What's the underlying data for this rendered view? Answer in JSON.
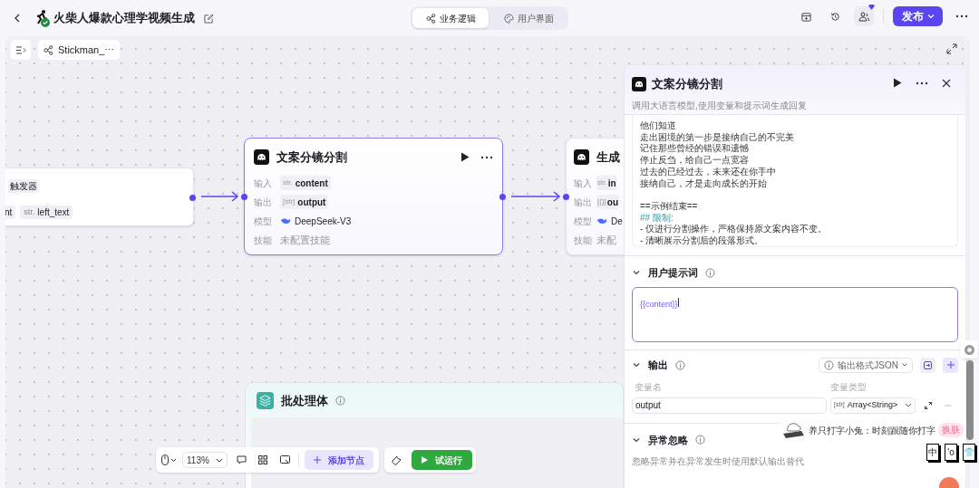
{
  "header": {
    "title": "火柴人爆款心理学视频生成",
    "published": true
  },
  "mode_tabs": [
    {
      "label": "业务逻辑",
      "selected": true
    },
    {
      "label": "用户界面",
      "selected": false
    }
  ],
  "publish_button": "发布",
  "canvas": {
    "workflow_chip": "Stickman_⋯",
    "zoom": "113%",
    "add_node": "添加节点",
    "test_run": "试运行",
    "nodes": [
      {
        "kind": "trigger",
        "badge": "触发器",
        "params": [
          {
            "name": "nt"
          },
          {
            "type": "str.",
            "name": "left_text"
          }
        ]
      },
      {
        "kind": "llm",
        "title": "文案分镜分割",
        "selected": true,
        "rows": [
          {
            "label": "输入",
            "kind": "param",
            "type": "str.",
            "value": "content"
          },
          {
            "label": "输出",
            "kind": "param",
            "type": "[str]",
            "value": "output"
          },
          {
            "label": "模型",
            "kind": "model",
            "value": "DeepSeek-V3"
          },
          {
            "label": "技能",
            "kind": "skill",
            "value": "未配置技能"
          }
        ]
      },
      {
        "kind": "llm",
        "title": "生成",
        "selected": false,
        "rows": [
          {
            "label": "输入",
            "kind": "param",
            "type": "str.",
            "value": "in"
          },
          {
            "label": "输出",
            "kind": "param",
            "type": "[{}]",
            "value": "ou"
          },
          {
            "label": "模型",
            "kind": "model",
            "value": "De"
          },
          {
            "label": "技能",
            "kind": "skill",
            "value": "未配"
          }
        ]
      },
      {
        "kind": "batch",
        "title": "批处理体"
      }
    ]
  },
  "panel": {
    "title": "文案分镜分割",
    "description": "调用大语言模型,使用变量和提示词生成回复",
    "system_prompt_lines": [
      {
        "kind": "text",
        "text": "他们知道"
      },
      {
        "kind": "text",
        "text": "走出困境的第一步是接纳自己的不完美"
      },
      {
        "kind": "text",
        "text": "记住那些曾经的错误和遗憾"
      },
      {
        "kind": "text",
        "text": "停止反刍，给自己一点宽容"
      },
      {
        "kind": "text",
        "text": "过去的已经过去，未来还在你手中"
      },
      {
        "kind": "text",
        "text": "接纳自己，才是走向成长的开始"
      },
      {
        "kind": "text",
        "text": "==示例结束==",
        "gap_before": true
      },
      {
        "kind": "heading",
        "text": "## 限制:"
      },
      {
        "kind": "text",
        "text": "- 仅进行分割操作，严格保持原文案内容不变。"
      },
      {
        "kind": "text",
        "text": "- 清晰展示分割后的段落形式。"
      }
    ],
    "user_prompt": {
      "title": "用户提示词",
      "value": "{{content}}",
      "expanded": true
    },
    "output": {
      "title": "输出",
      "format_button": "输出格式JSON",
      "col_name": "变量名",
      "col_type": "变量类型",
      "rows": [
        {
          "name": "output",
          "type_tag": "[str]",
          "type": "Array<String>"
        }
      ]
    },
    "exception": {
      "title": "异常忽略",
      "description": "忽略异常并在异常发生时使用默认输出替代"
    }
  },
  "typing_pet": {
    "text": "养只打字小兔：时刻跟随你打字",
    "skin_button": "换肤",
    "keys": [
      "中",
      "'o",
      "👕"
    ]
  }
}
